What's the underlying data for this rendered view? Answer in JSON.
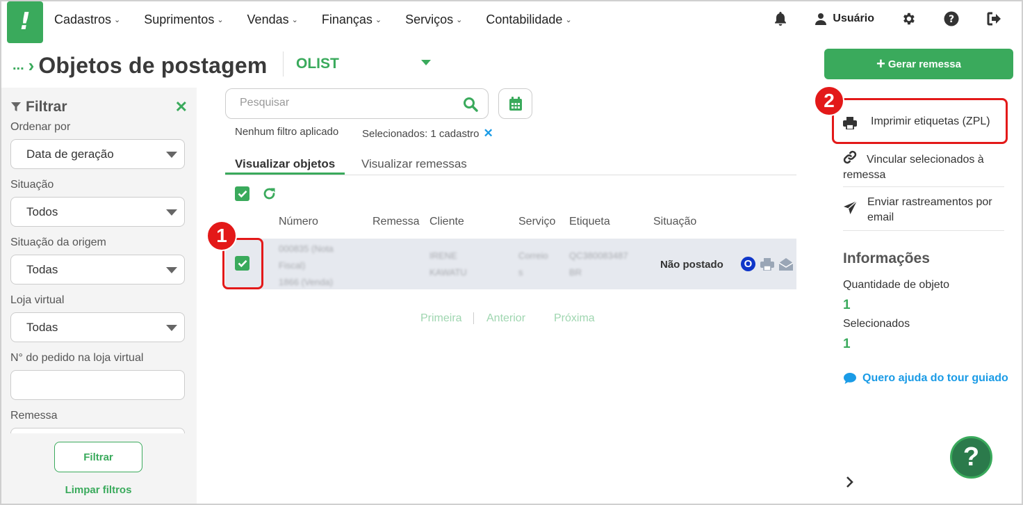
{
  "nav": {
    "logo": "!",
    "items": [
      {
        "label": "Cadastros"
      },
      {
        "label": "Suprimentos"
      },
      {
        "label": "Vendas"
      },
      {
        "label": "Finanças"
      },
      {
        "label": "Serviços"
      },
      {
        "label": "Contabilidade"
      }
    ],
    "user_label": "Usuário"
  },
  "header": {
    "ellipsis": "...",
    "title": "Objetos de postagem",
    "store": "OLIST",
    "generate_button": "Gerar remessa"
  },
  "filter": {
    "title": "Filtrar",
    "fields": {
      "sort_label": "Ordenar por",
      "sort_value": "Data de geração",
      "status_label": "Situação",
      "status_value": "Todos",
      "origin_label": "Situação da origem",
      "origin_value": "Todas",
      "store_label": "Loja virtual",
      "store_value": "Todas",
      "order_label": "N° do pedido na loja virtual",
      "order_value": "",
      "shipment_label": "Remessa"
    },
    "filter_button": "Filtrar",
    "clear_link": "Limpar filtros"
  },
  "main": {
    "search_placeholder": "Pesquisar",
    "no_filter": "Nenhum filtro aplicado",
    "selected_text": "Selecionados: 1 cadastro",
    "tabs": [
      {
        "label": "Visualizar objetos"
      },
      {
        "label": "Visualizar remessas"
      }
    ],
    "columns": [
      "Número",
      "Remessa",
      "Cliente",
      "Serviço",
      "Etiqueta",
      "Situação"
    ],
    "rows": [
      {
        "numero": [
          "000835 (Nota",
          "Fiscal)",
          "1866 (Venda)"
        ],
        "remessa": "",
        "cliente": [
          "IRENE",
          "KAWATU"
        ],
        "servico": [
          "Correio",
          "s"
        ],
        "etiqueta": [
          "QC380083487",
          "BR"
        ],
        "situacao": "Não postado",
        "badge": "O"
      }
    ],
    "pager": {
      "first": "Primeira",
      "prev": "Anterior",
      "next": "Próxima"
    }
  },
  "annotations": {
    "step1": "1",
    "step2": "2"
  },
  "actions": {
    "print_zpl": "Imprimir etiquetas (ZPL)",
    "link_selected": "Vincular selecionados à remessa",
    "send_tracking": "Enviar rastreamentos por email"
  },
  "info": {
    "title": "Informações",
    "qty_label": "Quantidade de objeto",
    "qty_value": "1",
    "selected_label": "Selecionados",
    "selected_value": "1",
    "help_link": "Quero ajuda do tour guiado",
    "fab": "?"
  },
  "colors": {
    "brand_green": "#3aaa5c",
    "link_blue": "#1a9be6",
    "annotation_red": "#e31919",
    "badge_blue": "#0f36c9"
  }
}
